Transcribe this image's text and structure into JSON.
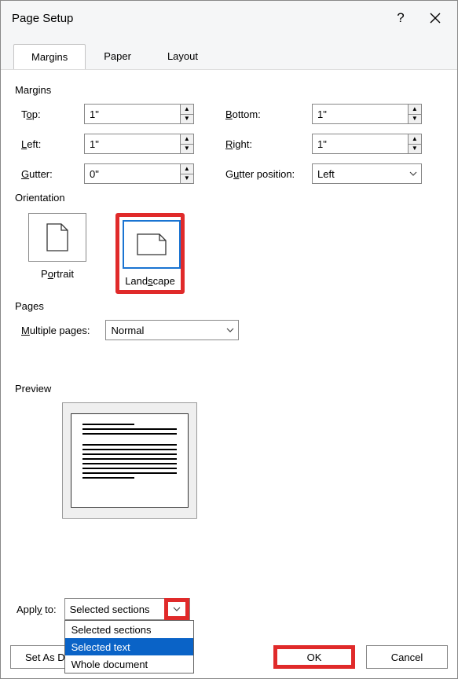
{
  "window": {
    "title": "Page Setup",
    "help": "?",
    "close": "✕"
  },
  "tabs": {
    "margins": "Margins",
    "paper": "Paper",
    "layout": "Layout"
  },
  "margins": {
    "group_label": "Margins",
    "top_label_pre": "T",
    "top_label_u": "o",
    "top_label_post": "p:",
    "top_value": "1\"",
    "bottom_label_u": "B",
    "bottom_label_post": "ottom:",
    "bottom_value": "1\"",
    "left_label_u": "L",
    "left_label_post": "eft:",
    "left_value": "1\"",
    "right_label_u": "R",
    "right_label_post": "ight:",
    "right_value": "1\"",
    "gutter_label_u": "G",
    "gutter_label_post": "utter:",
    "gutter_value": "0\"",
    "gutterpos_label_pre": "G",
    "gutterpos_label_u": "u",
    "gutterpos_label_post": "tter position:",
    "gutterpos_value": "Left"
  },
  "orientation": {
    "group_label": "Orientation",
    "portrait_pre": "P",
    "portrait_u": "o",
    "portrait_post": "rtrait",
    "landscape_pre": "Land",
    "landscape_u": "s",
    "landscape_post": "cape"
  },
  "pages": {
    "group_label": "Pages",
    "multiple_u": "M",
    "multiple_post": "ultiple pages:",
    "multiple_value": "Normal"
  },
  "preview": {
    "group_label": "Preview"
  },
  "apply": {
    "label_pre": "Appl",
    "label_u": "y",
    "label_post": " to:",
    "value": "Selected sections",
    "options": {
      "o1": "Selected sections",
      "o2": "Selected text",
      "o3": "Whole document"
    }
  },
  "buttons": {
    "set_default_pre": "Set As De",
    "set_default_u": "f",
    "set_default_post": "a",
    "ok": "OK",
    "cancel": "Cancel"
  }
}
